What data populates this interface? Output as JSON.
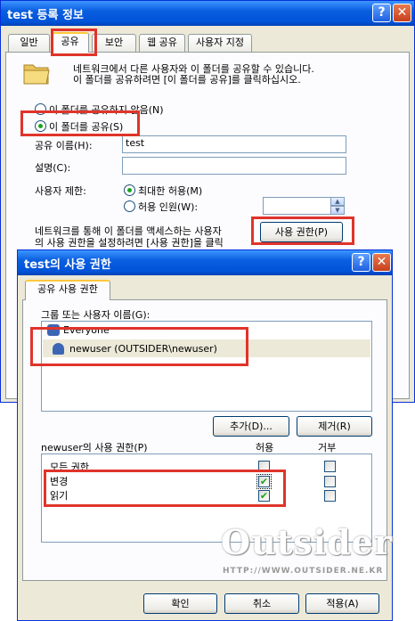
{
  "props": {
    "title": "test 등록 정보",
    "tabs": [
      "일반",
      "공유",
      "보안",
      "웹 공유",
      "사용자 지정"
    ],
    "description_line1": "네트워크에서 다른 사용자와 이 폴더를 공유할 수 있습니다.",
    "description_line2": "이 폴더를 공유하려면 [이 폴더를 공유]를 클릭하십시오.",
    "no_share_label": "이 폴더를 공유하지 않음(N)",
    "share_label": "이 폴더를 공유(S)",
    "share_name_label": "공유 이름(H):",
    "share_name_value": "test",
    "description_label": "설명(C):",
    "description_value": "",
    "user_limit_label": "사용자 제한:",
    "max_allowed_label": "최대한 허용(M)",
    "allow_users_label": "허용 인원(W):",
    "permissions_hint1": "네트워크를 통해 이 폴더를 액세스하는 사용자",
    "permissions_hint2": "의 사용 권한을 설정하려면 [사용 권한]을 클릭",
    "permissions_button": "사용 권한(P)"
  },
  "perm": {
    "title": "test의 사용 권한",
    "tab": "공유 사용 권한",
    "group_label": "그룹 또는 사용자 이름(G):",
    "users": [
      "Everyone",
      "newuser (OUTSIDER\\newuser)"
    ],
    "add_button": "추가(D)...",
    "remove_button": "제거(R)",
    "permissions_for": "newuser의 사용 권한(P)",
    "allow_header": "허용",
    "deny_header": "거부",
    "rows": [
      {
        "name": "모든 권한",
        "allow": false,
        "deny": false
      },
      {
        "name": "변경",
        "allow": true,
        "deny": false
      },
      {
        "name": "읽기",
        "allow": true,
        "deny": false
      }
    ],
    "ok_button": "확인",
    "cancel_button": "취소",
    "apply_button": "적용(A)"
  },
  "watermark": {
    "logo": "Outsider",
    "url": "HTTP://WWW.OUTSIDER.NE.KR"
  },
  "colors": {
    "title_blue": "#0052D6",
    "highlight_red": "#E0342B",
    "dialog_bg": "#ECE9D8",
    "check_green": "#21A121"
  }
}
